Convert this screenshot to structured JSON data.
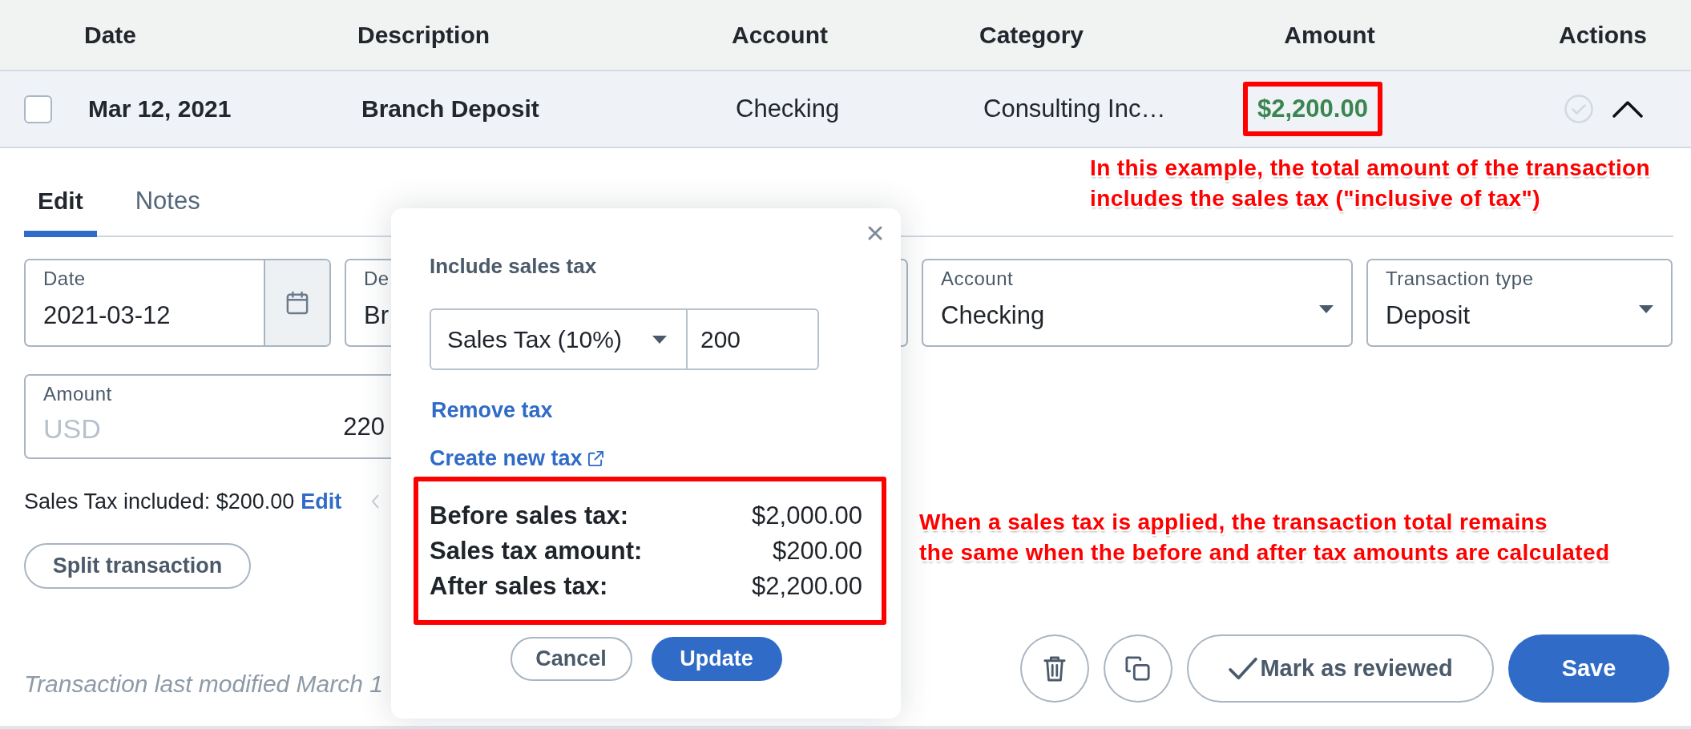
{
  "table": {
    "columns": [
      "Date",
      "Description",
      "Account",
      "Category",
      "Amount",
      "Actions"
    ],
    "rows": [
      {
        "kind": "deposit",
        "checked": false,
        "date": "Mar 12, 2021",
        "description": "Branch Deposit",
        "account": "Checking",
        "category": "Consulting Inc…",
        "amount": "$2,200.00",
        "amount_highlighted": true,
        "reviewed": false,
        "expanded": true
      }
    ]
  },
  "editor": {
    "tabs": [
      {
        "label": "Edit",
        "selected": true
      },
      {
        "label": "Notes",
        "selected": false
      }
    ],
    "fields": [
      {
        "kind": "date",
        "label": "Date",
        "value": "2021-03-12"
      },
      {
        "kind": "text",
        "label": "De",
        "value": "Br"
      },
      {
        "kind": "select",
        "label": "Account",
        "value": "Checking"
      },
      {
        "kind": "select",
        "label": "Transaction type",
        "value": "Deposit"
      }
    ],
    "amount_field": {
      "label": "Amount",
      "currency": "USD",
      "value": "220"
    },
    "tax_note": {
      "text": "Sales Tax included: $200.00",
      "link": "Edit"
    },
    "split_button": "Split transaction",
    "last_modified": "Transaction last modified March 1",
    "actions": [
      {
        "kind": "delete"
      },
      {
        "kind": "duplicate"
      },
      {
        "kind": "review",
        "label": "Mark as reviewed"
      },
      {
        "kind": "save",
        "label": "Save"
      }
    ]
  },
  "popover": {
    "title": "Include sales tax",
    "tax_select": "Sales Tax (10%)",
    "tax_amount": "200",
    "remove_link": "Remove tax",
    "create_link": "Create new tax",
    "summary_highlighted": true,
    "summary": [
      {
        "label": "Before sales tax:",
        "value": "$2,000.00"
      },
      {
        "label": "Sales tax amount:",
        "value": "$200.00"
      },
      {
        "label": "After sales tax:",
        "value": "$2,200.00"
      }
    ],
    "buttons": [
      {
        "kind": "secondary",
        "label": "Cancel"
      },
      {
        "kind": "primary",
        "label": "Update"
      }
    ]
  },
  "annotations": [
    {
      "text": "In this example, the total amount of the transaction\nincludes the sales tax (\"inclusive of tax\")"
    },
    {
      "text": "When a sales tax is applied, the transaction total remains\nthe same when the before and after tax amounts are calculated"
    }
  ]
}
